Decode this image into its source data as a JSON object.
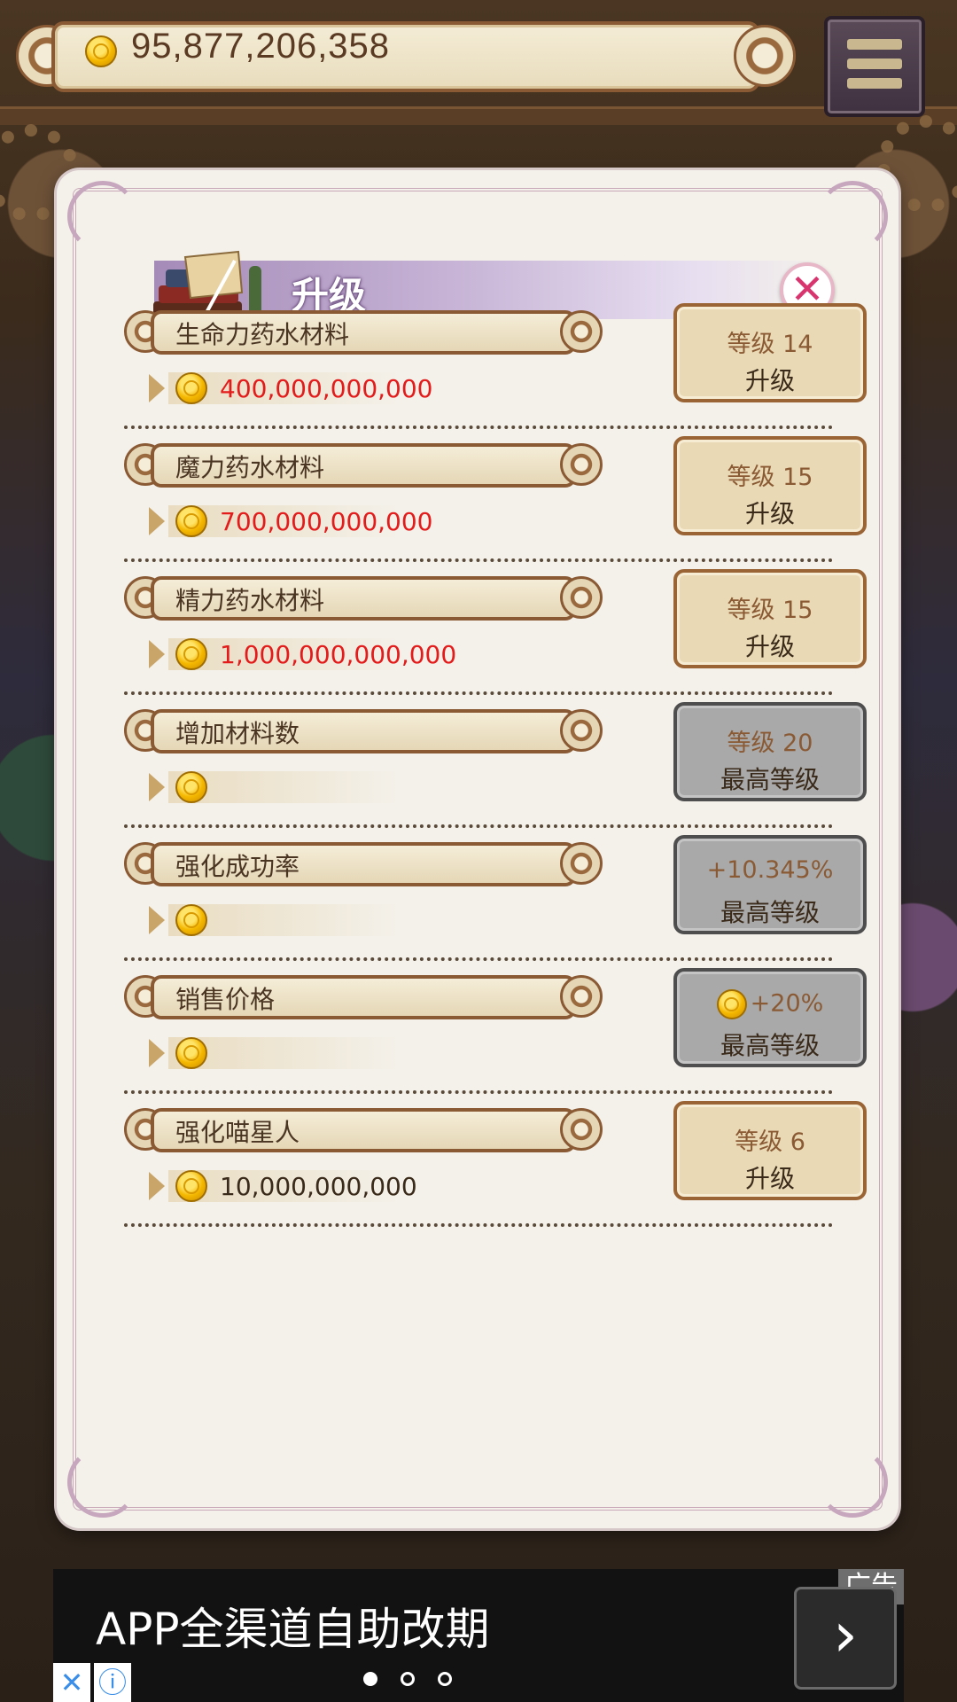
{
  "wallet": {
    "coins": "95,877,206,358",
    "coin_icon": "gold-coin-icon"
  },
  "menu": {
    "icon": "hamburger-menu-icon"
  },
  "dialog": {
    "title": "升级",
    "close_icon": "close-x-icon",
    "rows": [
      {
        "name": "生命力药水材料",
        "cost": "400,000,000,000",
        "cost_color": "#e31b1b",
        "btn_line1": "等级 14",
        "btn_line2": "升级",
        "state": "upgradable"
      },
      {
        "name": "魔力药水材料",
        "cost": "700,000,000,000",
        "cost_color": "#e31b1b",
        "btn_line1": "等级 15",
        "btn_line2": "升级",
        "state": "upgradable"
      },
      {
        "name": "精力药水材料",
        "cost": "1,000,000,000,000",
        "cost_color": "#e31b1b",
        "btn_line1": "等级 15",
        "btn_line2": "升级",
        "state": "upgradable"
      },
      {
        "name": "增加材料数",
        "cost": "",
        "btn_line1": "等级 20",
        "btn_line2": "最高等级",
        "state": "max"
      },
      {
        "name": "强化成功率",
        "cost": "",
        "btn_line1": "+10.345%",
        "btn_line2": "最高等级",
        "state": "max"
      },
      {
        "name": "销售价格",
        "cost": "",
        "btn_line1": "+20%",
        "btn_line2": "最高等级",
        "state": "max",
        "btn_has_coin": true
      },
      {
        "name": "强化喵星人",
        "cost": "10,000,000,000",
        "cost_color": "#3a2a1a",
        "btn_line1": "等级 6",
        "btn_line2": "升级",
        "state": "upgradable"
      }
    ]
  },
  "ad": {
    "headline": "APP全渠道自助改期",
    "tag": "广告",
    "arrow": "›",
    "close": "✕",
    "info": "ⓘ",
    "pages": 3,
    "active_page": 1
  }
}
